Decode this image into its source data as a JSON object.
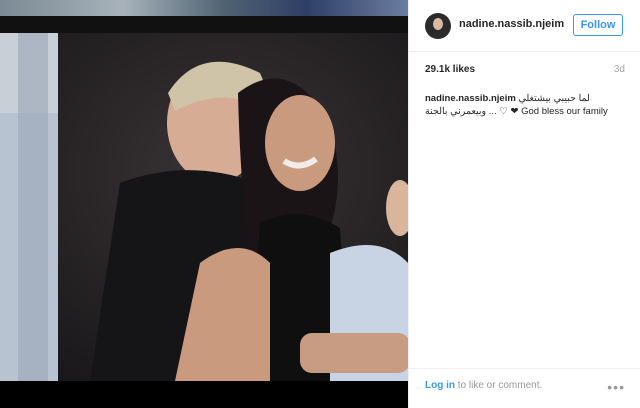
{
  "post": {
    "username": "nadine.nassib.njeim",
    "follow_label": "Follow",
    "likes": "29.1k likes",
    "time": "3d",
    "caption_user": "nadine.nassib.njeim",
    "caption_text": "لما حبيبي بيشتغلي وبيعمرني بالجنة ... ♡ ❤ God bless our family"
  },
  "footer": {
    "login_link": "Log in",
    "login_rest": " to like or comment.",
    "more_icon": "more-options-icon"
  },
  "colors": {
    "accent": "#3897f0",
    "text": "#262626",
    "muted": "#999999"
  }
}
